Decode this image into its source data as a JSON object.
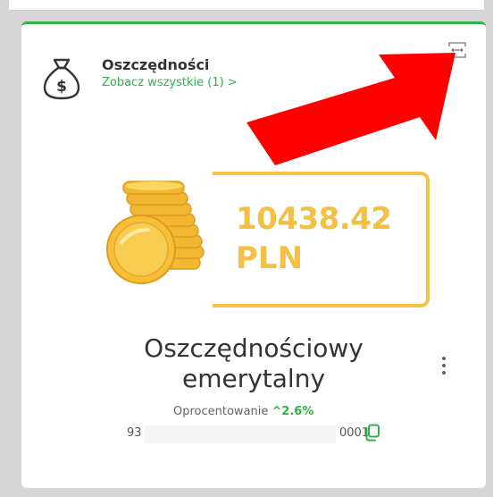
{
  "card": {
    "title": "Oszczędności",
    "see_all_label": "Zobacz wszystkie (1) >",
    "header_icon": "money-bag-icon",
    "expand_icon": "expand-horizontal-icon"
  },
  "account": {
    "amount": "10438.42",
    "currency": "PLN",
    "name": "Oszczędnościowy emerytalny",
    "rate_label": "Oprocentowanie",
    "rate_value": "^2.6%",
    "number_prefix": "93",
    "number_suffix": "0001",
    "copy_icon": "copy-icon",
    "menu_icon": "more-vertical-icon"
  },
  "colors": {
    "accent": "#2fb24a",
    "gold": "#f3c043",
    "annotation_arrow": "#ff0000"
  }
}
